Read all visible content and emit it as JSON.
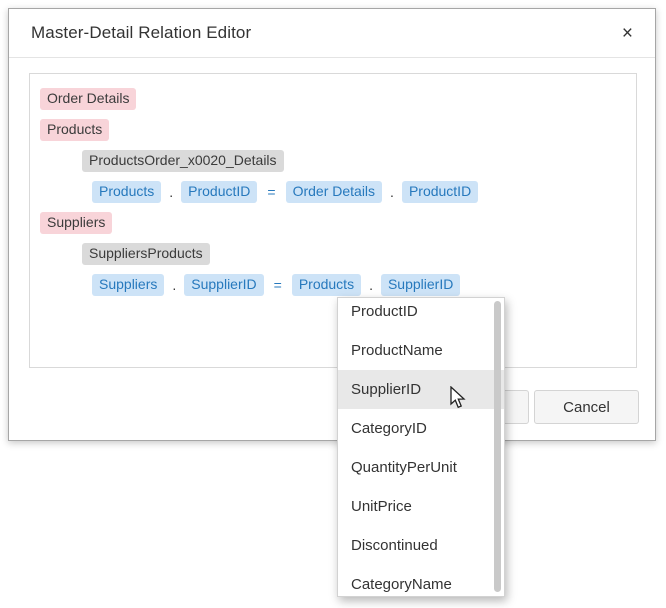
{
  "dialog": {
    "title": "Master-Detail Relation Editor",
    "close_icon": "×"
  },
  "symbols": {
    "dot": ".",
    "equals": "="
  },
  "tree": {
    "table1": {
      "label": "Order Details"
    },
    "table2": {
      "label": "Products"
    },
    "relation1": {
      "label": "ProductsOrder_x0020_Details"
    },
    "eq1": {
      "left_table": "Products",
      "left_field": "ProductID",
      "right_table": "Order Details",
      "right_field": "ProductID"
    },
    "table3": {
      "label": "Suppliers"
    },
    "relation2": {
      "label": "SuppliersProducts"
    },
    "eq2": {
      "left_table": "Suppliers",
      "left_field": "SupplierID",
      "right_table": "Products",
      "right_field": "SupplierID"
    }
  },
  "dropdown": {
    "items": [
      {
        "label": "ProductID"
      },
      {
        "label": "ProductName"
      },
      {
        "label": "SupplierID"
      },
      {
        "label": "CategoryID"
      },
      {
        "label": "QuantityPerUnit"
      },
      {
        "label": "UnitPrice"
      },
      {
        "label": "Discontinued"
      },
      {
        "label": "CategoryName"
      }
    ],
    "highlighted_item": "SupplierID"
  },
  "footer": {
    "cancel_label": "Cancel"
  },
  "colors": {
    "table_badge_bg": "#f8d4d9",
    "relation_badge_bg": "#dadada",
    "field_badge_bg": "#cde3f7",
    "field_text": "#2779bd",
    "selected_item_bg": "#e8e8e8"
  }
}
